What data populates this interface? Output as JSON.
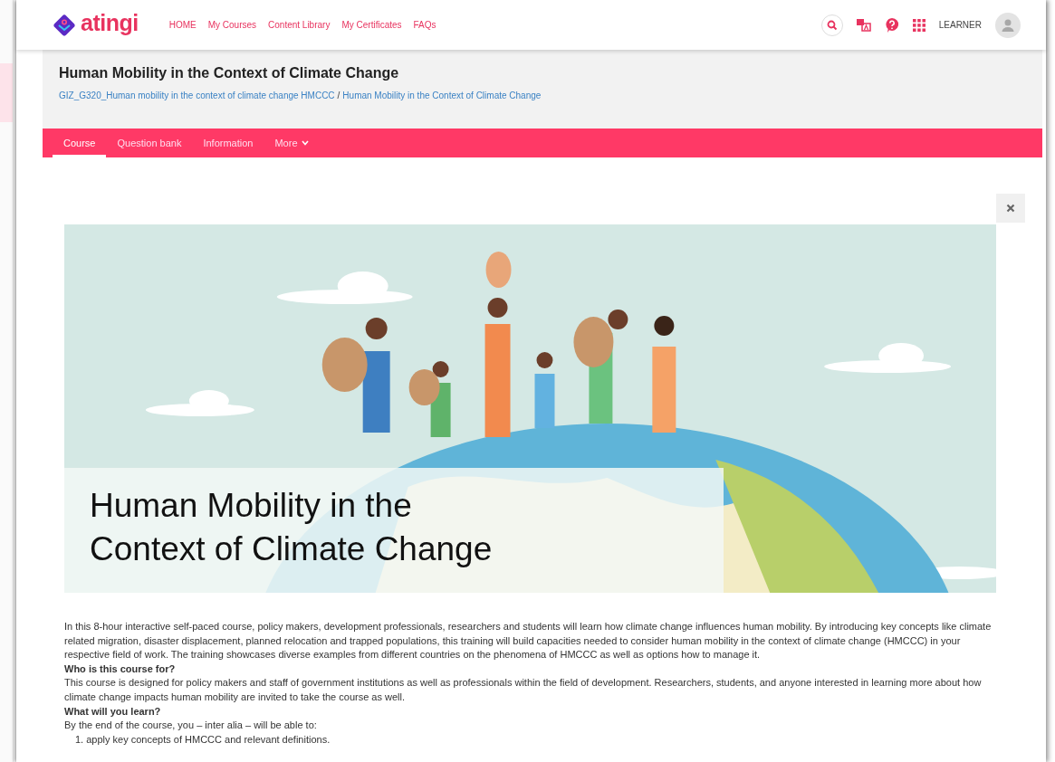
{
  "header": {
    "logo": "atingi",
    "nav": [
      {
        "label": "HOME"
      },
      {
        "label": "My Courses"
      },
      {
        "label": "Content Library"
      },
      {
        "label": "My Certificates"
      },
      {
        "label": "FAQs"
      }
    ],
    "user_role": "LEARNER"
  },
  "page_header": {
    "title": "Human Mobility in the Context of Climate Change",
    "breadcrumb": [
      "GIZ_G320_Human mobility in the context of climate change HMCCC",
      "Human Mobility in the Context of Climate Change"
    ],
    "breadcrumb_separator": "/"
  },
  "tabs": [
    {
      "label": "Course",
      "selected": true,
      "kind": "link"
    },
    {
      "label": "Question bank",
      "selected": false,
      "kind": "link"
    },
    {
      "label": "Information",
      "selected": false,
      "kind": "link"
    },
    {
      "label": "More",
      "selected": false,
      "kind": "dropdown"
    }
  ],
  "banner": {
    "caption_lines": [
      "Human Mobility in the",
      "Context of Climate Change"
    ]
  },
  "description": [
    {
      "kind": "paragraph",
      "text": "In this 8-hour interactive self-paced course, policy makers, development professionals, researchers and students will learn how climate change influences human mobility. By introducing key concepts like climate related migration, disaster displacement, planned relocation and trapped populations, this training will build capacities needed to consider human mobility in the context of climate change (HMCCC) in your respective field of work. The training showcases diverse examples from different countries on the phenomena of HMCCC as well as options how to manage it."
    },
    {
      "kind": "heading",
      "text": "Who is this course for?"
    },
    {
      "kind": "paragraph",
      "text": "This course is designed for policy makers and staff of government institutions as well as professionals within the field of development. Researchers, students, and anyone interested in learning more about how climate change impacts human mobility are invited to take the course as well."
    },
    {
      "kind": "heading",
      "text": "What will you learn?"
    },
    {
      "kind": "paragraph",
      "text": "By the end of the course, you – inter alia – will be able to:"
    },
    {
      "kind": "list_item",
      "number": "1.",
      "text": "apply key concepts of HMCCC and relevant definitions."
    }
  ]
}
